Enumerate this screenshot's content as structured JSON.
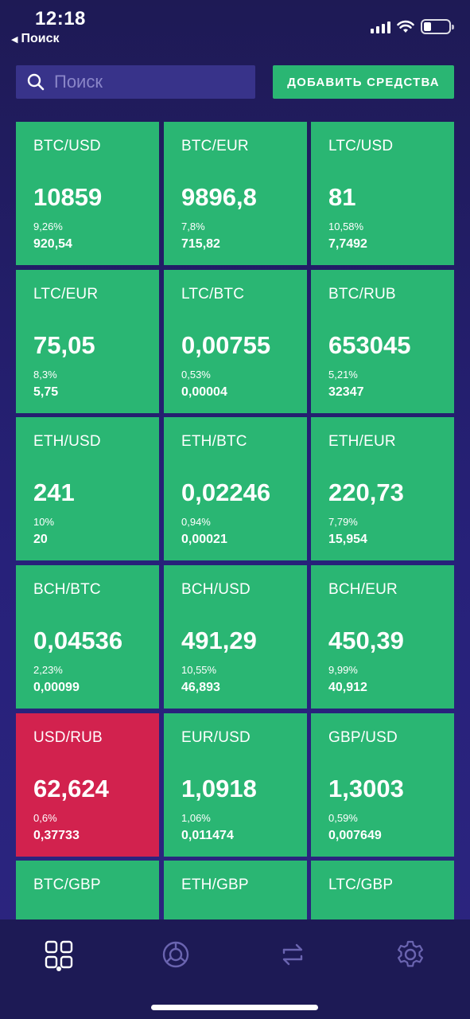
{
  "status": {
    "time": "12:18",
    "back_label": "Поиск"
  },
  "search": {
    "placeholder": "Поиск"
  },
  "actions": {
    "add_funds_label": "ДОБАВИТЬ СРЕДСТВА"
  },
  "colors": {
    "up": "#2ab673",
    "down": "#d2224e",
    "background": "#231e6a"
  },
  "tiles": [
    {
      "pair": "BTC/USD",
      "price": "10859",
      "percent": "9,26%",
      "change": "920,54",
      "trend": "up"
    },
    {
      "pair": "BTC/EUR",
      "price": "9896,8",
      "percent": "7,8%",
      "change": "715,82",
      "trend": "up"
    },
    {
      "pair": "LTC/USD",
      "price": "81",
      "percent": "10,58%",
      "change": "7,7492",
      "trend": "up"
    },
    {
      "pair": "LTC/EUR",
      "price": "75,05",
      "percent": "8,3%",
      "change": "5,75",
      "trend": "up"
    },
    {
      "pair": "LTC/BTC",
      "price": "0,00755",
      "percent": "0,53%",
      "change": "0,00004",
      "trend": "up"
    },
    {
      "pair": "BTC/RUB",
      "price": "653045",
      "percent": "5,21%",
      "change": "32347",
      "trend": "up"
    },
    {
      "pair": "ETH/USD",
      "price": "241",
      "percent": "10%",
      "change": "20",
      "trend": "up"
    },
    {
      "pair": "ETH/BTC",
      "price": "0,02246",
      "percent": "0,94%",
      "change": "0,00021",
      "trend": "up"
    },
    {
      "pair": "ETH/EUR",
      "price": "220,73",
      "percent": "7,79%",
      "change": "15,954",
      "trend": "up"
    },
    {
      "pair": "BCH/BTC",
      "price": "0,04536",
      "percent": "2,23%",
      "change": "0,00099",
      "trend": "up"
    },
    {
      "pair": "BCH/USD",
      "price": "491,29",
      "percent": "10,55%",
      "change": "46,893",
      "trend": "up"
    },
    {
      "pair": "BCH/EUR",
      "price": "450,39",
      "percent": "9,99%",
      "change": "40,912",
      "trend": "up"
    },
    {
      "pair": "USD/RUB",
      "price": "62,624",
      "percent": "0,6%",
      "change": "0,37733",
      "trend": "down"
    },
    {
      "pair": "EUR/USD",
      "price": "1,0918",
      "percent": "1,06%",
      "change": "0,011474",
      "trend": "up"
    },
    {
      "pair": "GBP/USD",
      "price": "1,3003",
      "percent": "0,59%",
      "change": "0,007649",
      "trend": "up"
    },
    {
      "pair": "BTC/GBP",
      "price": "",
      "percent": "",
      "change": "",
      "trend": "up"
    },
    {
      "pair": "ETH/GBP",
      "price": "",
      "percent": "",
      "change": "",
      "trend": "up"
    },
    {
      "pair": "LTC/GBP",
      "price": "",
      "percent": "",
      "change": "",
      "trend": "up"
    }
  ],
  "tabs": [
    {
      "icon": "grid-icon",
      "active": true
    },
    {
      "icon": "pie-chart-icon",
      "active": false
    },
    {
      "icon": "exchange-icon",
      "active": false
    },
    {
      "icon": "gear-icon",
      "active": false
    }
  ]
}
